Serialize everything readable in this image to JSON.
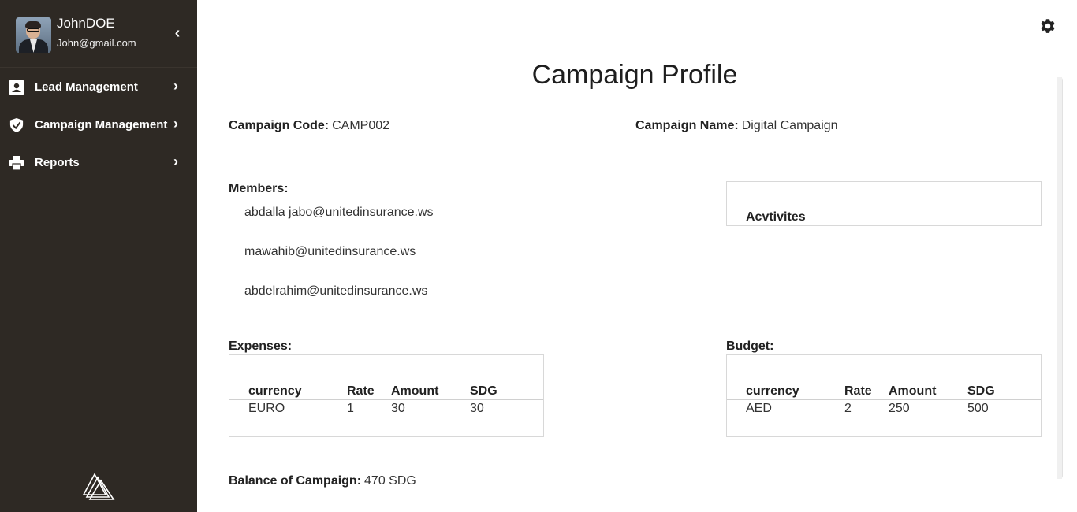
{
  "sidebar": {
    "user": {
      "name": "JohnDOE",
      "email": "John@gmail.com"
    },
    "items": [
      {
        "label": "Lead Management",
        "icon": "contact-card-icon"
      },
      {
        "label": "Campaign Management",
        "icon": "checked-shield-icon"
      },
      {
        "label": "Reports",
        "icon": "printer-icon"
      }
    ],
    "collapse_icon": "chevron-left-icon",
    "logo_icon": "triangles-logo-icon"
  },
  "header": {
    "settings_icon": "gear-icon"
  },
  "main": {
    "title": "Campaign Profile",
    "campaign_code": {
      "label": "Campaign Code:",
      "value": "CAMP002"
    },
    "campaign_name": {
      "label": "Campaign Name:",
      "value": "Digital Campaign"
    },
    "members": {
      "label": "Members:",
      "list": [
        "abdalla jabo@unitedinsurance.ws",
        "mawahib@unitedinsurance.ws",
        "abdelrahim@unitedinsurance.ws"
      ]
    },
    "activities": {
      "label": "Acvtivites"
    },
    "expenses": {
      "label": "Expenses:",
      "columns": [
        "currency",
        "Rate",
        "Amount",
        "SDG"
      ],
      "rows": [
        [
          "EURO",
          "1",
          "30",
          "30"
        ]
      ]
    },
    "budget": {
      "label": "Budget:",
      "columns": [
        "currency",
        "Rate",
        "Amount",
        "SDG"
      ],
      "rows": [
        [
          "AED",
          "2",
          "250",
          "500"
        ]
      ]
    },
    "balance": {
      "label": "Balance of Campaign:",
      "value": "470 SDG"
    }
  }
}
